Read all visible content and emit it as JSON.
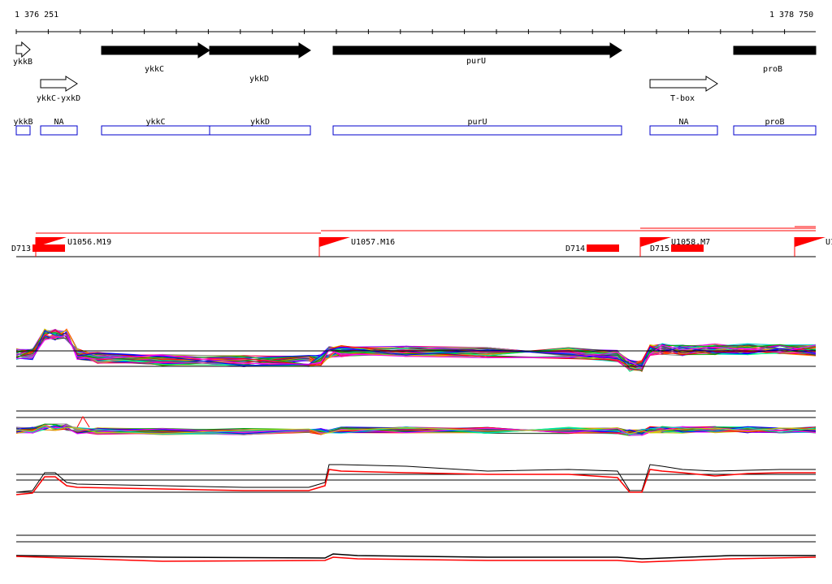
{
  "ruler": {
    "start_label": "1 376 251",
    "end_label": "1 378 750",
    "start": 1376251,
    "end": 1378750
  },
  "genes_top": [
    {
      "name": "ykkB",
      "strand": "+",
      "filled": false
    },
    {
      "name": "ykkC",
      "strand": "+",
      "filled": true
    },
    {
      "name": "ykkD",
      "strand": "+",
      "filled": true
    },
    {
      "name": "purU",
      "strand": "+",
      "filled": true
    },
    {
      "name": "proB",
      "strand": "+",
      "filled": true
    }
  ],
  "genes_second": [
    {
      "name": "ykkC-yxkD",
      "strand": "+",
      "filled": false
    },
    {
      "name": "T-box",
      "strand": "+",
      "filled": false
    }
  ],
  "annotation_boxes": [
    {
      "label": "ykkB"
    },
    {
      "label": "NA"
    },
    {
      "label": "ykkC"
    },
    {
      "label": "ykkD"
    },
    {
      "label": "purU"
    },
    {
      "label": "NA"
    },
    {
      "label": "proB"
    }
  ],
  "segments": {
    "upshifts": [
      "U1056.M19",
      "U1057.M16",
      "U1058.M7",
      "U1"
    ],
    "downshifts": [
      "D713",
      "D714",
      "D715"
    ]
  },
  "colors": {
    "gene_fill": "#000000",
    "box_stroke": "#0000cc",
    "segment_red": "#ff0000",
    "axis": "#000000"
  }
}
